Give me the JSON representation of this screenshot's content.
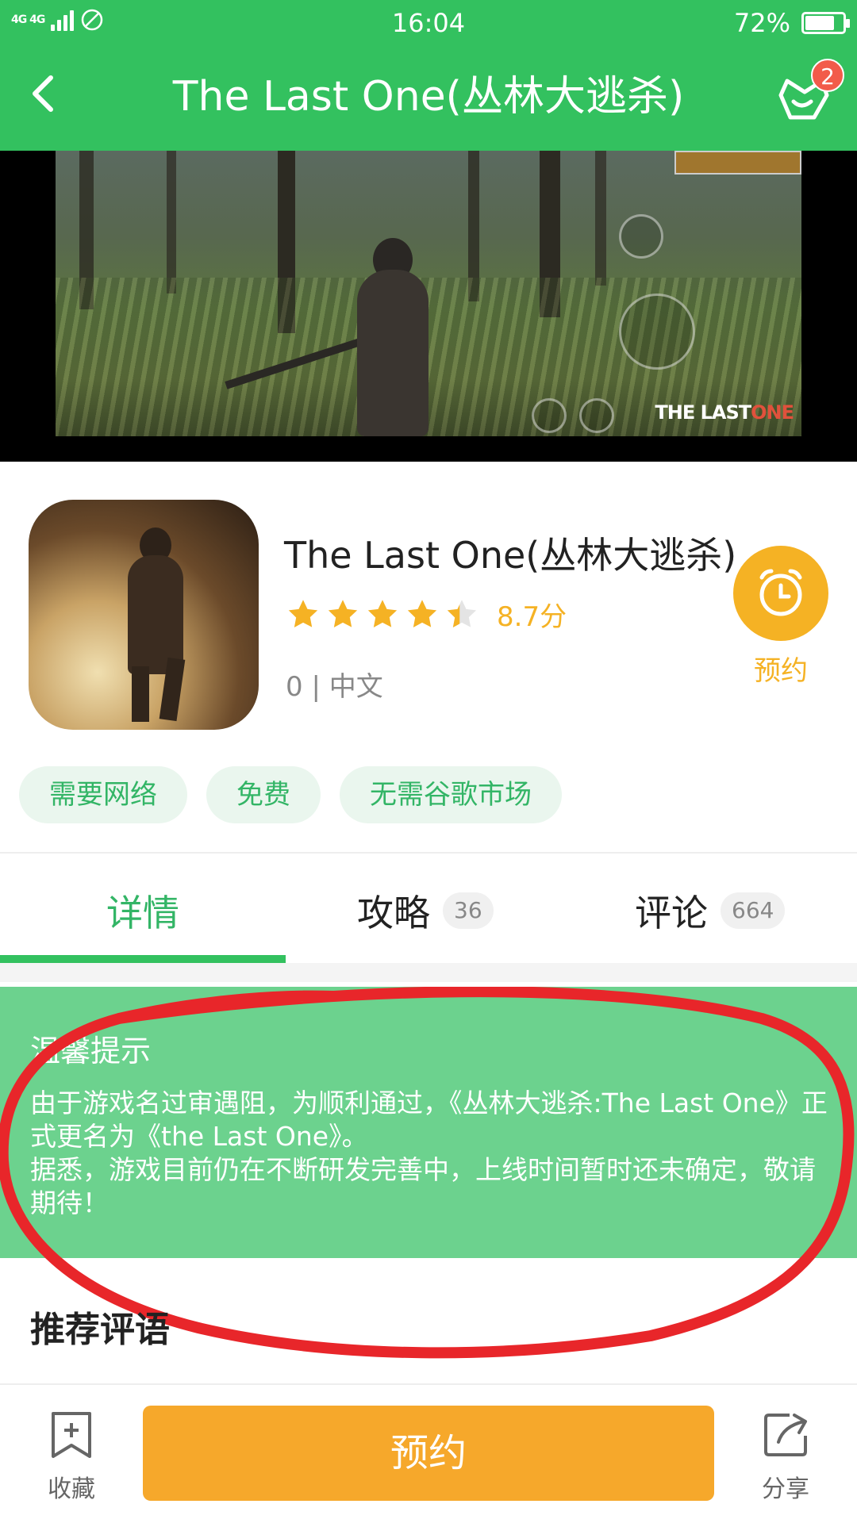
{
  "status_bar": {
    "network": "4G 4G",
    "time": "16:04",
    "battery": "72%"
  },
  "header": {
    "title": "The Last One(丛林大逃杀)",
    "download_badge": "2"
  },
  "video": {
    "watermark_text": "THE LAST",
    "watermark_accent": "ONE"
  },
  "app": {
    "name": "The Last One(丛林大逃杀)",
    "rating_stars": 4.35,
    "score": "8.7分",
    "meta": "0 | 中文",
    "reserve_label": "预约"
  },
  "tags": [
    "需要网络",
    "免费",
    "无需谷歌市场"
  ],
  "tabs": [
    {
      "label": "详情",
      "count": ""
    },
    {
      "label": "攻略",
      "count": "36"
    },
    {
      "label": "评论",
      "count": "664"
    }
  ],
  "notice": {
    "title": "温馨提示",
    "line1": "由于游戏名过审遇阻，为顺利通过，《丛林大逃杀:The Last One》正式更名为《the Last One》。",
    "line2": "据悉，游戏目前仍在不断研发完善中，上线时间暂时还未确定，敬请期待！"
  },
  "recommend": {
    "title": "推荐评语"
  },
  "footer": {
    "favorite": "收藏",
    "cta": "预约",
    "share": "分享"
  },
  "colors": {
    "brand_green": "#33c15f",
    "notice_green": "#6cd28e",
    "accent_orange": "#f6a82b",
    "star_yellow": "#f5b224",
    "annotation_red": "#e8262a"
  }
}
